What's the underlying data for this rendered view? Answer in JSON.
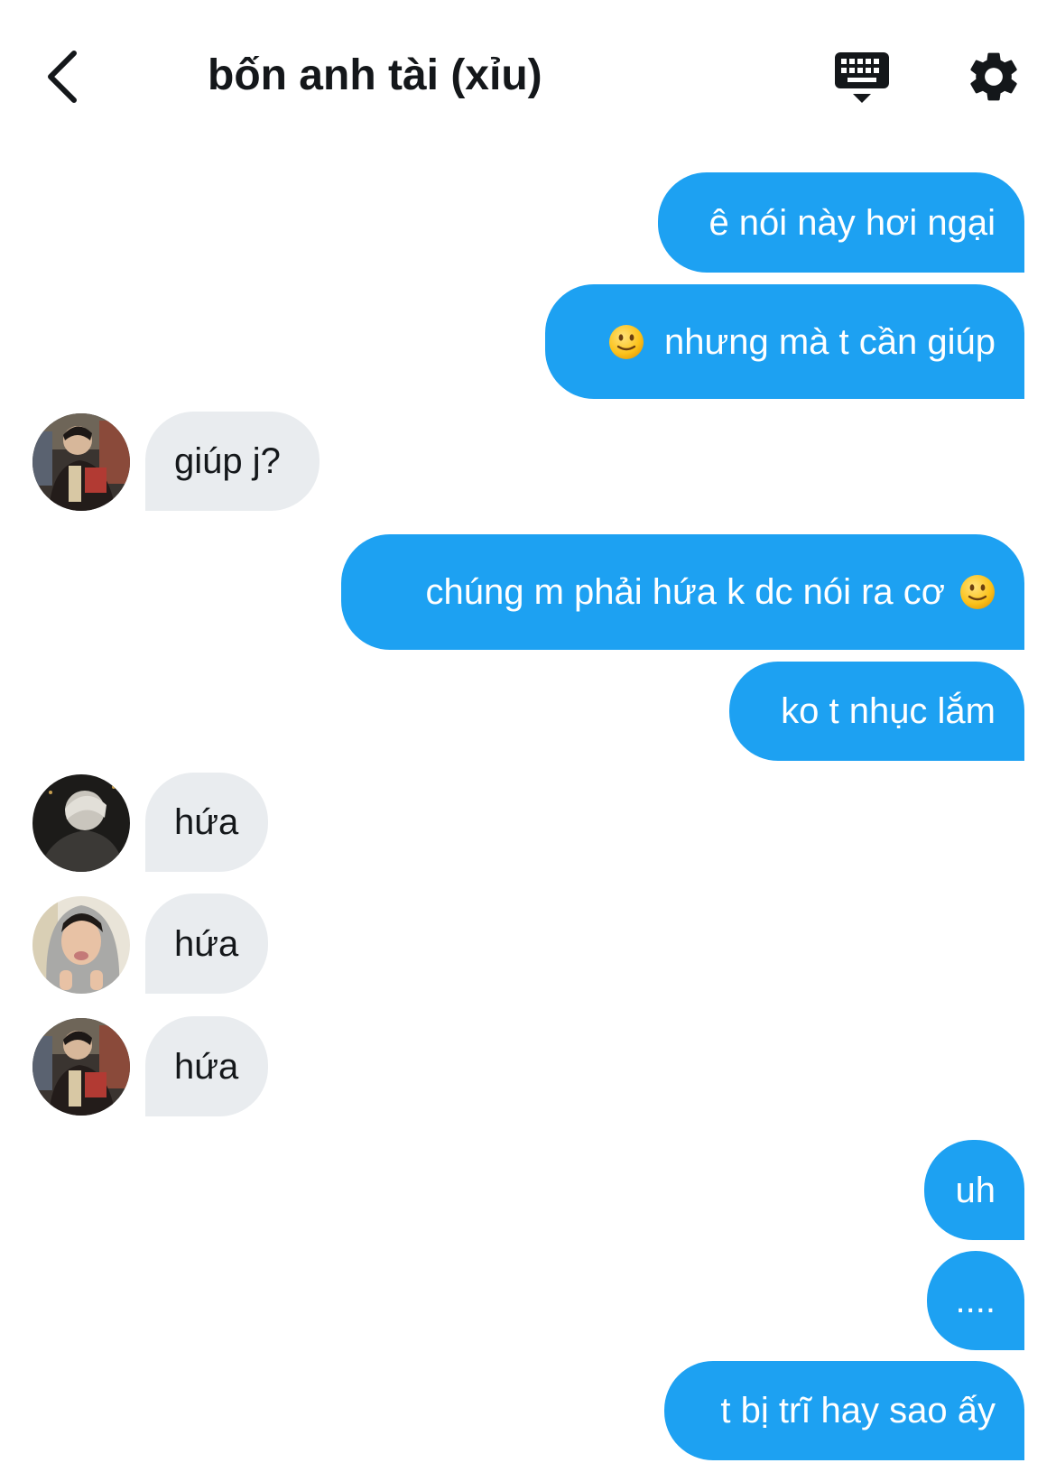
{
  "header": {
    "title": "bốn anh tài (xỉu)",
    "back_icon": "chevron-left-icon",
    "keyboard_icon": "keyboard-icon",
    "settings_icon": "gear-icon"
  },
  "colors": {
    "outgoing_bubble": "#1da1f2",
    "incoming_bubble": "#e9ecef",
    "text": "#14171a"
  },
  "messages": {
    "m1": "ê nói này hơi ngại",
    "m2": "nhưng mà t cần giúp",
    "m3": "giúp j?",
    "m4": "chúng m phải hứa k dc nói ra cơ",
    "m5": "ko t nhục lắm",
    "m6": "hứa",
    "m7": "hứa",
    "m8": "hứa",
    "m9": "uh",
    "m10": "....",
    "m11": "t bị trĩ hay sao ấy"
  },
  "emoji": {
    "slight_smile": "slightly-smiling-face"
  }
}
